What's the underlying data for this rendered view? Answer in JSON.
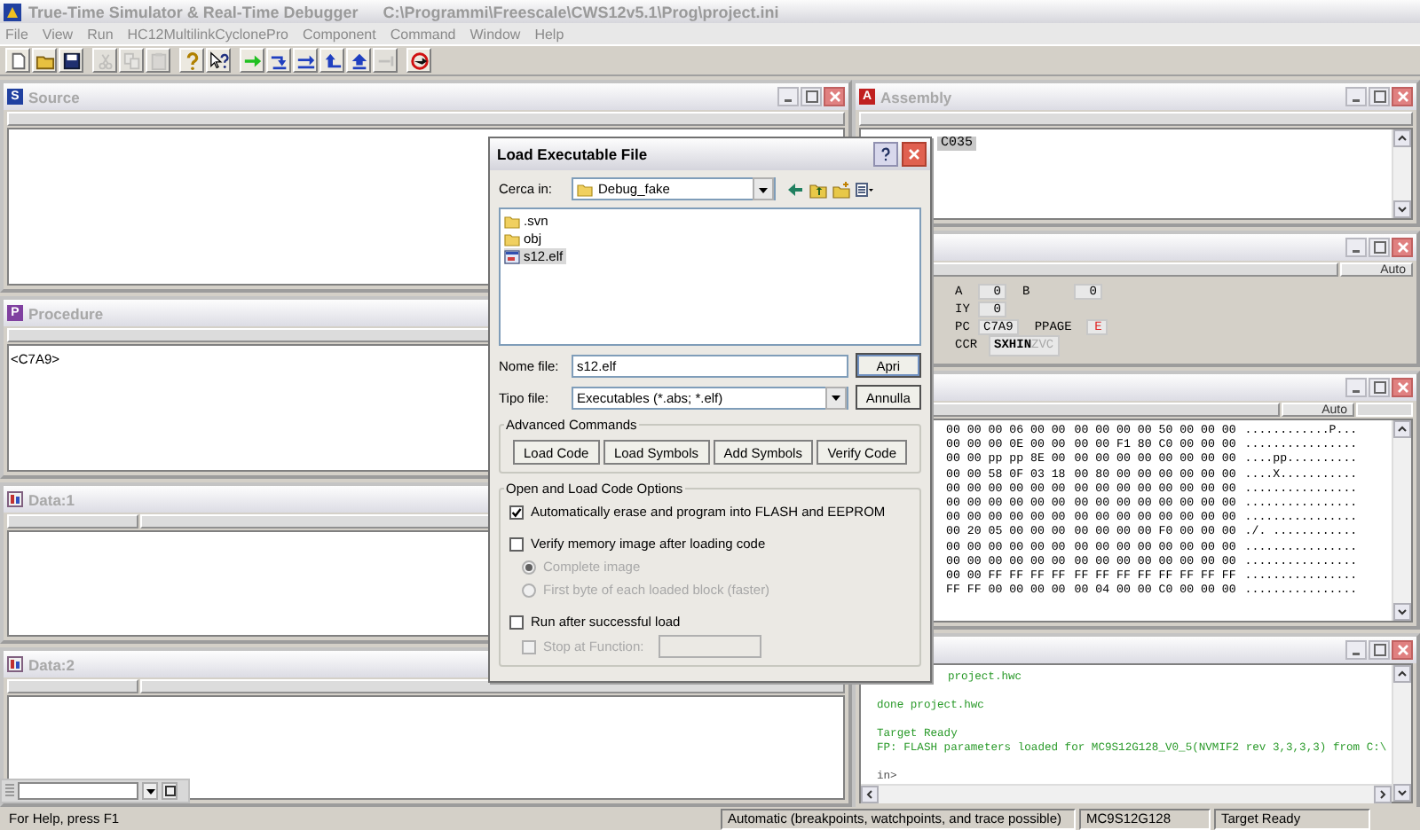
{
  "window": {
    "title": "True-Time Simulator & Real-Time Debugger",
    "path": "C:\\Programmi\\Freescale\\CWS12v5.1\\Prog\\project.ini"
  },
  "menu": [
    "File",
    "View",
    "Run",
    "HC12MultilinkCyclonePro",
    "Component",
    "Command",
    "Window",
    "Help"
  ],
  "toolbar": [
    [
      {
        "kind": "new",
        "disabled": false
      },
      {
        "kind": "open",
        "disabled": false
      },
      {
        "kind": "save",
        "disabled": false
      }
    ],
    [
      {
        "kind": "cut",
        "disabled": true
      },
      {
        "kind": "copy",
        "disabled": true
      },
      {
        "kind": "paste",
        "disabled": true
      }
    ],
    [
      {
        "kind": "help",
        "disabled": false
      },
      {
        "kind": "context-help",
        "disabled": false
      }
    ],
    [
      {
        "kind": "start",
        "disabled": false
      },
      {
        "kind": "step-in",
        "disabled": false
      },
      {
        "kind": "step-over",
        "disabled": false
      },
      {
        "kind": "step-out",
        "disabled": false
      },
      {
        "kind": "assembly-step",
        "disabled": false
      },
      {
        "kind": "halt",
        "disabled": true
      }
    ],
    [
      {
        "kind": "reset",
        "disabled": false
      }
    ]
  ],
  "left_windows": [
    {
      "kind": "source",
      "title": "Source",
      "icon": "S",
      "window_buttons": true
    },
    {
      "kind": "procedure",
      "title": "Procedure",
      "icon": "P",
      "lines": [
        "<C7A9>"
      ]
    },
    {
      "kind": "data",
      "title": "Data:1"
    },
    {
      "kind": "data",
      "title": "Data:2"
    }
  ],
  "right_windows": [
    {
      "kind": "assembly",
      "title": "Assembly",
      "icon": "A",
      "lines": [
        "C035"
      ],
      "window_buttons": true
    },
    {
      "kind": "register",
      "mode": "Auto",
      "window_buttons": true
    },
    {
      "kind": "memory",
      "mode": "Auto",
      "window_buttons": true
    },
    {
      "kind": "command",
      "window_buttons": true
    }
  ],
  "register": {
    "rows": [
      [
        {
          "label": "A",
          "value": "0",
          "changed": false
        },
        {
          "label": "B",
          "value": "0",
          "changed": false
        }
      ],
      [
        {
          "label": "IY",
          "value": "0",
          "changed": false
        }
      ],
      [
        {
          "label": "PC",
          "value": "C7A9",
          "changed": false
        },
        {
          "label": "PPAGE",
          "value": "E",
          "changed": true
        }
      ]
    ],
    "ccr": {
      "label": "CCR",
      "bits": [
        {
          "bit": "S",
          "set": true
        },
        {
          "bit": "X",
          "set": true
        },
        {
          "bit": "H",
          "set": true
        },
        {
          "bit": "I",
          "set": true
        },
        {
          "bit": "N",
          "set": true
        },
        {
          "bit": "Z",
          "set": false
        },
        {
          "bit": "V",
          "set": false
        },
        {
          "bit": "C",
          "set": false
        }
      ]
    }
  },
  "memory": {
    "rows": [
      {
        "bytes_a": "00 00 00 06 00 00",
        "bytes_b": "00 00 00 00 50 00 00 00",
        "ascii": "............P..."
      },
      {
        "bytes_a": "00 00 00 0E 00 00",
        "bytes_b": "00 00 F1 80 C0 00 00 00",
        "ascii": "................"
      },
      {
        "bytes_a": "00 00 pp pp 8E 00",
        "bytes_b": "00 00 00 00 00 00 00 00",
        "ascii": "....pp.........."
      },
      {
        "bytes_a": "00 00 58 0F 03 18",
        "bytes_b": "00 80 00 00 00 00 00 00",
        "ascii": "....X..........."
      },
      {
        "bytes_a": "00 00 00 00 00 00",
        "bytes_b": "00 00 00 00 00 00 00 00",
        "ascii": "................"
      },
      {
        "bytes_a": "00 00 00 00 00 00",
        "bytes_b": "00 00 00 00 00 00 00 00",
        "ascii": "................"
      },
      {
        "bytes_a": "00 00 00 00 00 00",
        "bytes_b": "00 00 00 00 00 00 00 00",
        "ascii": "................"
      },
      {
        "bytes_a": "00 20 05 00 00 00",
        "bytes_b": "00 00 00 00 F0 00 00 00",
        "ascii": "./. ............"
      },
      {
        "bytes_a": "00 00 00 00 00 00",
        "bytes_b": "00 00 00 00 00 00 00 00",
        "ascii": "................"
      },
      {
        "bytes_a": "00 00 00 00 00 00",
        "bytes_b": "00 00 00 00 00 00 00 00",
        "ascii": "................"
      },
      {
        "bytes_a": "00 00 FF FF FF FF",
        "bytes_b": "FF FF FF FF FF FF FF FF",
        "ascii": "................"
      },
      {
        "bytes_a": "FF FF 00 00 00 00",
        "bytes_b": "00 04 00 00 C0 00 00 00",
        "ascii": "................"
      }
    ]
  },
  "command": {
    "blocks": [
      {
        "kind": "output",
        "lines": [
          "project.hwc"
        ]
      },
      {
        "kind": "output",
        "lines": [
          "done project.hwc"
        ]
      },
      {
        "kind": "output",
        "lines": [
          "Target Ready",
          "FP: FLASH parameters loaded for MC9S12G128_V0_5(NVMIF2 rev 3,3,3,3) from C:\\"
        ]
      },
      {
        "kind": "prompt",
        "lines": [
          "in>"
        ]
      }
    ]
  },
  "dialog": {
    "title": "Load Executable File",
    "look_in_label": "Cerca in:",
    "look_in": "Debug_fake",
    "files": [
      {
        "name": ".svn",
        "kind": "folder",
        "selected": false
      },
      {
        "name": "obj",
        "kind": "folder",
        "selected": false
      },
      {
        "name": "s12.elf",
        "kind": "file",
        "selected": true
      }
    ],
    "file_name_label": "Nome file:",
    "file_name": "s12.elf",
    "open_button": "Apri",
    "file_type_label": "Tipo file:",
    "file_type": "Executables (*.abs; *.elf)",
    "cancel_button": "Annulla",
    "advanced": {
      "title": "Advanced Commands",
      "buttons": [
        "Load Code",
        "Load Symbols",
        "Add Symbols",
        "Verify Code"
      ]
    },
    "options": {
      "title": "Open and Load Code Options",
      "items": [
        {
          "kind": "checkbox",
          "label": "Automatically erase and program into FLASH and EEPROM",
          "checked": true,
          "disabled": false
        },
        {
          "kind": "checkbox",
          "label": "Verify memory image after loading code",
          "checked": false,
          "disabled": false
        },
        {
          "kind": "radio",
          "label": "Complete image",
          "selected": true,
          "disabled": true
        },
        {
          "kind": "radio",
          "label": "First byte of each loaded block (faster)",
          "selected": false,
          "disabled": true
        },
        {
          "kind": "checkbox",
          "label": "Run after successful load",
          "checked": false,
          "disabled": false
        },
        {
          "kind": "checkbox-field",
          "label": "Stop at Function:",
          "checked": false,
          "disabled": true
        }
      ]
    }
  },
  "status_bar": [
    "For Help, press F1",
    "Automatic (breakpoints, watchpoints, and trace possible)",
    "MC9S12G128",
    "Target Ready"
  ]
}
